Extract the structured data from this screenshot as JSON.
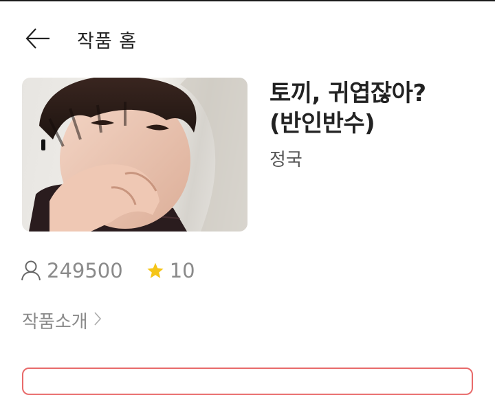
{
  "header": {
    "back_icon": "arrow-left-icon",
    "title": "작품 홈"
  },
  "work": {
    "title_lines": [
      "토끼, 귀엽잖아?",
      "(반인반수)"
    ],
    "author": "정국",
    "cover_alt": "cover image"
  },
  "stats": {
    "views_icon": "person-icon",
    "views": "249500",
    "rating_icon": "star-icon",
    "rating": "10",
    "star_color": "#f5c518"
  },
  "intro": {
    "label": "작품소개",
    "chevron_icon": "chevron-right-icon"
  },
  "colors": {
    "accent_border": "#e86a6a",
    "text_primary": "#222222",
    "text_secondary": "#8a8a8a"
  }
}
